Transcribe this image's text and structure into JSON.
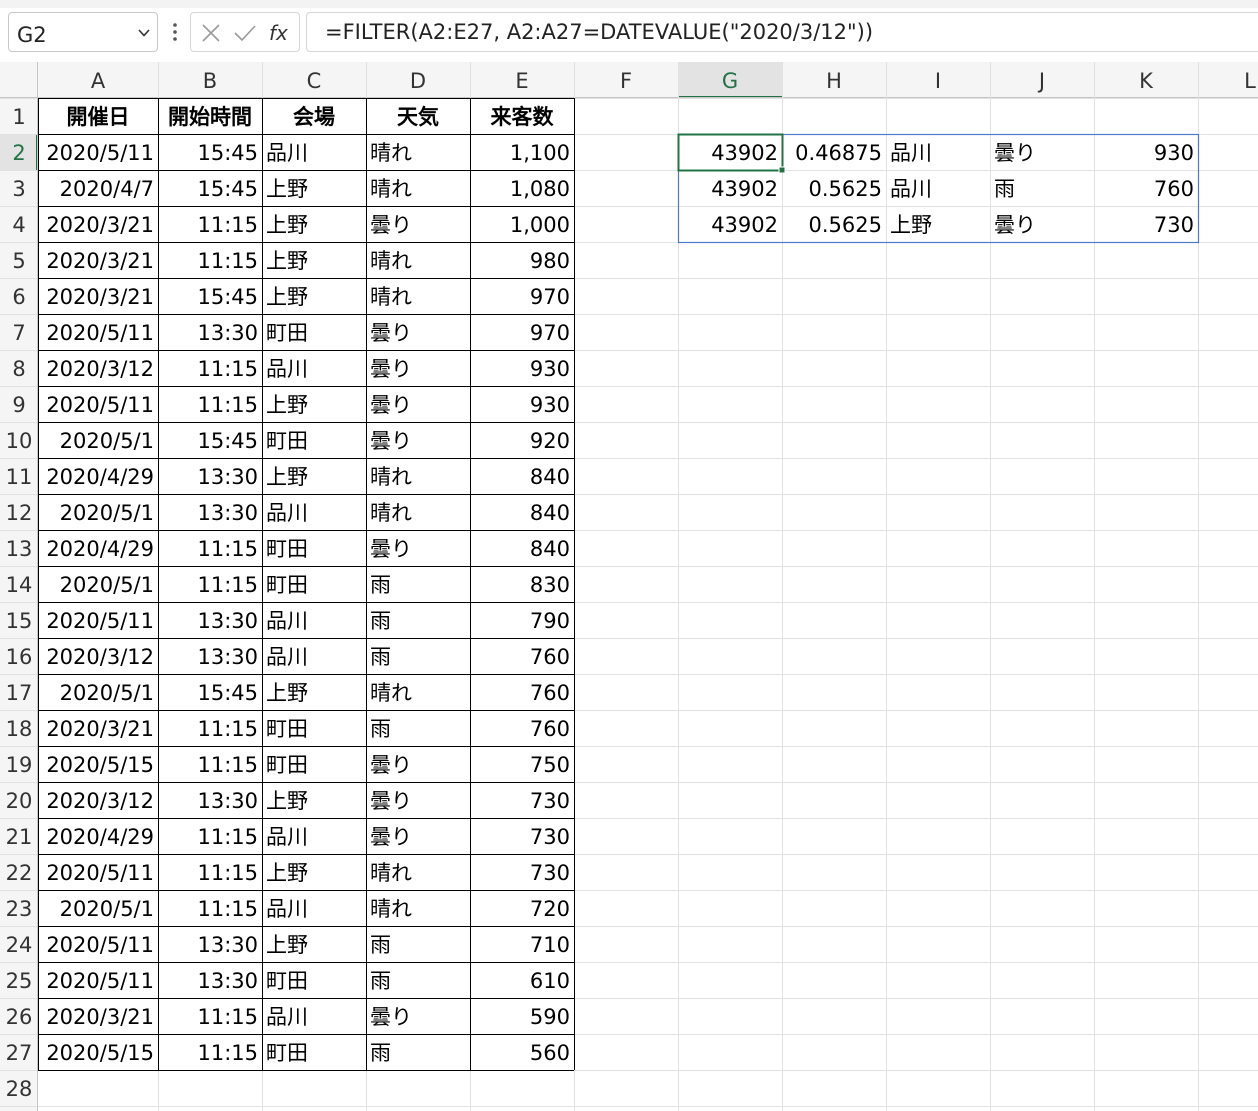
{
  "formula_bar": {
    "name_box": "G2",
    "formula": "=FILTER(A2:E27, A2:A27=DATEVALUE(\"2020/3/12\"))",
    "cancel_icon": "x-icon",
    "enter_icon": "check-icon",
    "function_icon": "fx-icon"
  },
  "sheet": {
    "columns": [
      "A",
      "B",
      "C",
      "D",
      "E",
      "F",
      "G",
      "H",
      "I",
      "J",
      "K",
      "L"
    ],
    "active_column": "G",
    "active_row": 2,
    "row_numbers": [
      1,
      2,
      3,
      4,
      5,
      6,
      7,
      8,
      9,
      10,
      11,
      12,
      13,
      14,
      15,
      16,
      17,
      18,
      19,
      20,
      21,
      22,
      23,
      24,
      25,
      26,
      27,
      28
    ],
    "header": [
      "開催日",
      "開始時間",
      "会場",
      "天気",
      "来客数"
    ],
    "rows": [
      [
        "2020/5/11",
        "15:45",
        "品川",
        "晴れ",
        "1,100"
      ],
      [
        "2020/4/7",
        "15:45",
        "上野",
        "晴れ",
        "1,080"
      ],
      [
        "2020/3/21",
        "11:15",
        "上野",
        "曇り",
        "1,000"
      ],
      [
        "2020/3/21",
        "11:15",
        "上野",
        "晴れ",
        "980"
      ],
      [
        "2020/3/21",
        "15:45",
        "上野",
        "晴れ",
        "970"
      ],
      [
        "2020/5/11",
        "13:30",
        "町田",
        "曇り",
        "970"
      ],
      [
        "2020/3/12",
        "11:15",
        "品川",
        "曇り",
        "930"
      ],
      [
        "2020/5/11",
        "11:15",
        "上野",
        "曇り",
        "930"
      ],
      [
        "2020/5/1",
        "15:45",
        "町田",
        "曇り",
        "920"
      ],
      [
        "2020/4/29",
        "13:30",
        "上野",
        "晴れ",
        "840"
      ],
      [
        "2020/5/1",
        "13:30",
        "品川",
        "晴れ",
        "840"
      ],
      [
        "2020/4/29",
        "11:15",
        "町田",
        "曇り",
        "840"
      ],
      [
        "2020/5/1",
        "11:15",
        "町田",
        "雨",
        "830"
      ],
      [
        "2020/5/11",
        "13:30",
        "品川",
        "雨",
        "790"
      ],
      [
        "2020/3/12",
        "13:30",
        "品川",
        "雨",
        "760"
      ],
      [
        "2020/5/1",
        "15:45",
        "上野",
        "晴れ",
        "760"
      ],
      [
        "2020/3/21",
        "11:15",
        "町田",
        "雨",
        "760"
      ],
      [
        "2020/5/15",
        "11:15",
        "町田",
        "曇り",
        "750"
      ],
      [
        "2020/3/12",
        "13:30",
        "上野",
        "曇り",
        "730"
      ],
      [
        "2020/4/29",
        "11:15",
        "品川",
        "曇り",
        "730"
      ],
      [
        "2020/5/11",
        "11:15",
        "上野",
        "晴れ",
        "730"
      ],
      [
        "2020/5/1",
        "11:15",
        "品川",
        "晴れ",
        "720"
      ],
      [
        "2020/5/11",
        "13:30",
        "上野",
        "雨",
        "710"
      ],
      [
        "2020/5/11",
        "13:30",
        "町田",
        "雨",
        "610"
      ],
      [
        "2020/3/21",
        "11:15",
        "品川",
        "曇り",
        "590"
      ],
      [
        "2020/5/15",
        "11:15",
        "町田",
        "雨",
        "560"
      ]
    ],
    "filter_results": [
      [
        "43902",
        "0.46875",
        "品川",
        "曇り",
        "930"
      ],
      [
        "43902",
        "0.5625",
        "品川",
        "雨",
        "760"
      ],
      [
        "43902",
        "0.5625",
        "上野",
        "曇り",
        "730"
      ]
    ],
    "colors": {
      "grid_line": "#e1e1e1",
      "header_bg": "#f5f5f5",
      "active_header_bg": "#e3e3e3",
      "active_accent": "#217346",
      "spill_border": "#4e79c9",
      "table_border": "#000000"
    }
  }
}
